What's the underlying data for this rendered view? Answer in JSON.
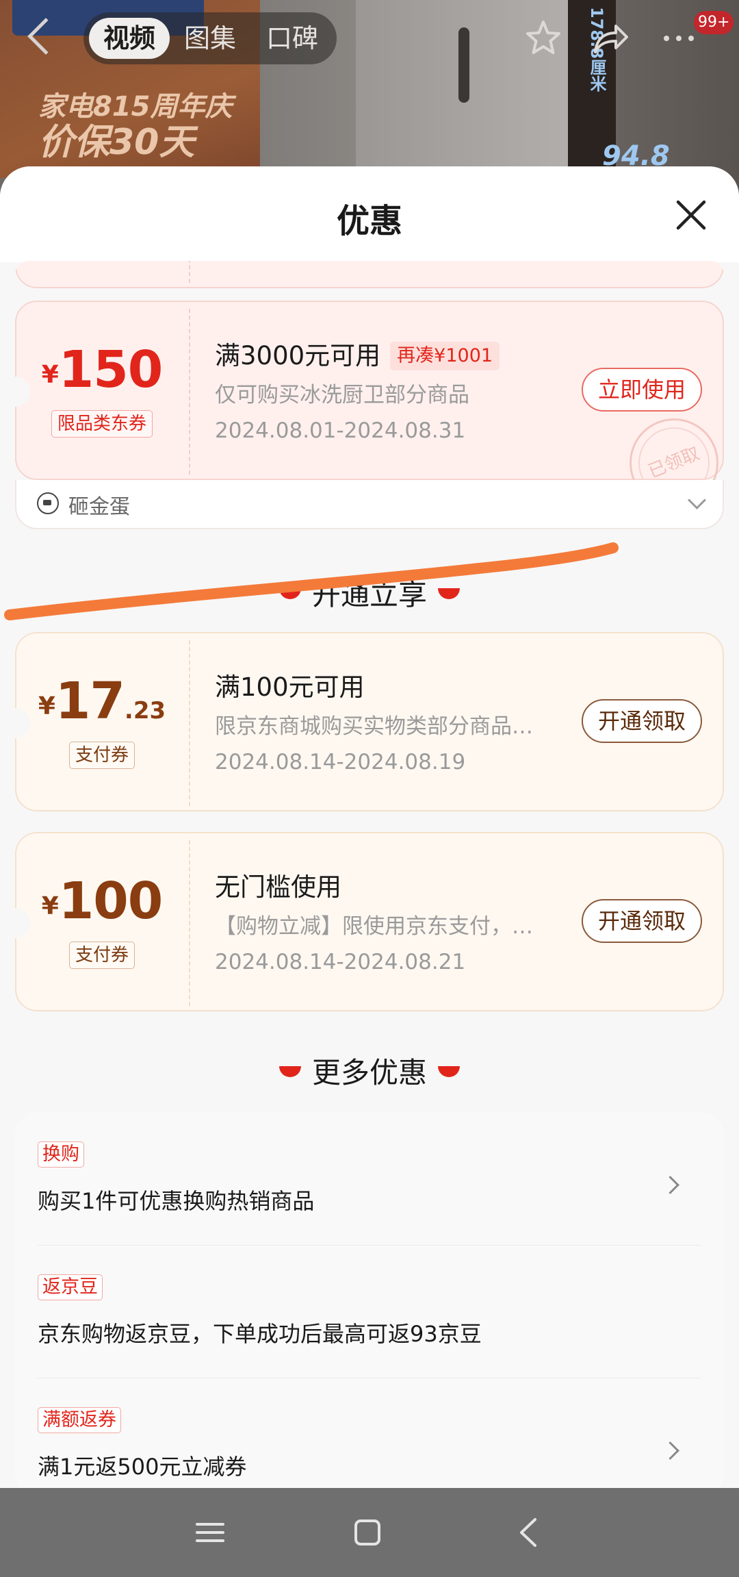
{
  "background": {
    "promo_line1": "家电815周年庆",
    "promo_line2": "价保30天",
    "measure_vertical": "178.8厘米",
    "measure_horizontal": "94.8"
  },
  "topbar": {
    "tabs": [
      {
        "label": "视频",
        "active": true
      },
      {
        "label": "图集",
        "active": false
      },
      {
        "label": "口碑",
        "active": false
      }
    ],
    "badge": "99+"
  },
  "sheet": {
    "title": "优惠",
    "coupons": [
      {
        "currency": "¥",
        "amount": "150",
        "amount_decimal": "",
        "tag": "限品类东券",
        "title": "满3000元可用",
        "extra": "再凑¥1001",
        "desc": "仅可购买冰洗厨卫部分商品",
        "date": "2024.08.01-2024.08.31",
        "button": "立即使用",
        "stamp": "已领取",
        "footer": "砸金蛋"
      }
    ],
    "section_open": "开通立享",
    "open_coupons": [
      {
        "currency": "¥",
        "amount": "17",
        "amount_decimal": ".23",
        "tag": "支付券",
        "title": "满100元可用",
        "desc": "限京东商城购买实物类部分商品…",
        "date": "2024.08.14-2024.08.19",
        "button": "开通领取"
      },
      {
        "currency": "¥",
        "amount": "100",
        "amount_decimal": "",
        "tag": "支付券",
        "title": "无门槛使用",
        "desc": "【购物立减】限使用京东支付，…",
        "date": "2024.08.14-2024.08.21",
        "button": "开通领取"
      }
    ],
    "section_more": "更多优惠",
    "more_items": [
      {
        "tag": "换购",
        "text": "购买1件可优惠换购热销商品",
        "has_arrow": true
      },
      {
        "tag": "返京豆",
        "text": "京东购物返京豆，下单成功后最高可返93京豆",
        "has_arrow": false
      },
      {
        "tag": "满额返券",
        "text": "满1元返500元立减券",
        "has_arrow": true
      }
    ]
  },
  "colors": {
    "accent_red": "#e1251b",
    "gold_text": "#8a3d10",
    "scribble": "#f47a3a"
  }
}
